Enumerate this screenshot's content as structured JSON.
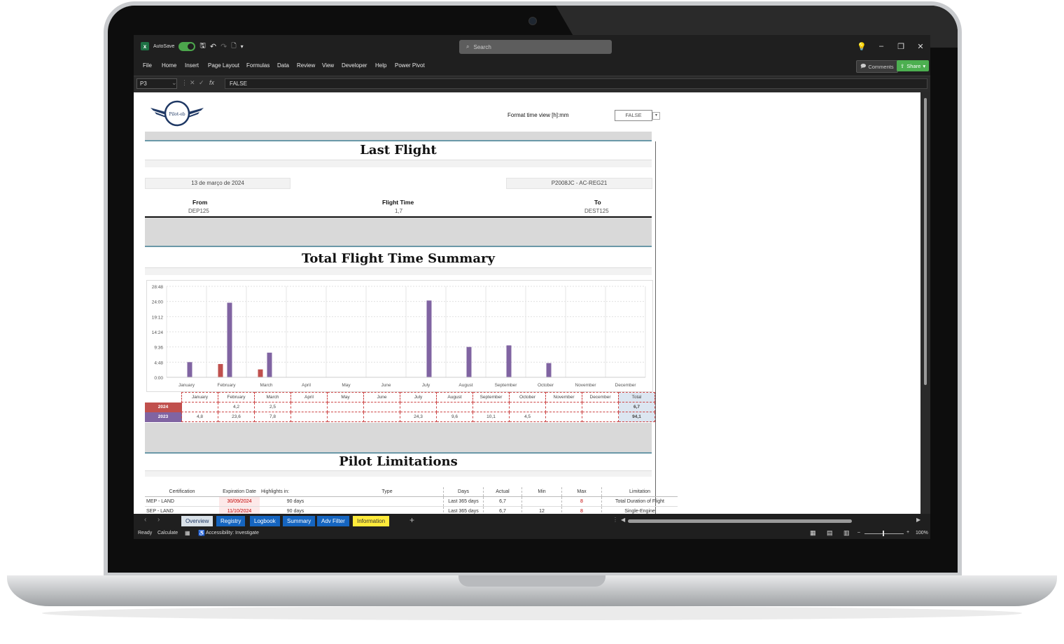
{
  "app": {
    "autosave_label": "AutoSave",
    "search_placeholder": "Search",
    "comments_label": "Comments",
    "share_label": "Share"
  },
  "menu": [
    "File",
    "Home",
    "Insert",
    "Page Layout",
    "Formulas",
    "Data",
    "Review",
    "View",
    "Developer",
    "Help",
    "Power Pivot"
  ],
  "formula_bar": {
    "cell_ref": "P3",
    "value": "FALSE"
  },
  "sheet": {
    "format_label": "Format time view [h]:mm",
    "format_value": "FALSE",
    "logo_text": "Pilot-eb",
    "last_flight": {
      "title": "Last Flight",
      "date": "13 de março de 2024",
      "aircraft": "P2008JC - AC-REG21",
      "from_label": "From",
      "from_value": "DEP125",
      "flight_time_label": "Flight Time",
      "flight_time_value": "1,7",
      "to_label": "To",
      "to_value": "DEST125"
    },
    "summary_title": "Total Flight Time Summary",
    "limitations": {
      "title": "Pilot Limitations",
      "headers": [
        "Certification",
        "Expiration Date",
        "Highlights in:",
        "Type",
        "Days",
        "Actual",
        "Min",
        "Max",
        "Limitation"
      ],
      "rows": [
        [
          "MEP - LAND",
          "30/09/2024",
          "90  days",
          "",
          "Last 365 days",
          "6,7",
          "",
          "8",
          "Total Duration of Flight"
        ],
        [
          "SEP - LAND",
          "11/10/2024",
          "90  days",
          "",
          "Last 365 days",
          "6,7",
          "12",
          "8",
          "Single-Engine"
        ]
      ]
    }
  },
  "chart_data": {
    "type": "bar",
    "categories": [
      "January",
      "February",
      "March",
      "April",
      "May",
      "June",
      "July",
      "August",
      "September",
      "October",
      "November",
      "December"
    ],
    "y_ticks": [
      "0:00",
      "4:48",
      "9:36",
      "14:24",
      "19:12",
      "24:00",
      "28:48"
    ],
    "ylim": [
      0,
      28.8
    ],
    "series": [
      {
        "name": "2024",
        "color": "#c0504d",
        "values": [
          0,
          4.2,
          2.5,
          0,
          0,
          0,
          0,
          0,
          0,
          0,
          0,
          0
        ]
      },
      {
        "name": "2023",
        "color": "#8064a2",
        "values": [
          4.8,
          23.6,
          7.8,
          0,
          0,
          0,
          24.3,
          9.6,
          10.1,
          4.5,
          0,
          0
        ]
      }
    ],
    "table": {
      "headers": [
        "January",
        "February",
        "March",
        "April",
        "May",
        "June",
        "July",
        "August",
        "September",
        "October",
        "November",
        "December",
        "Total"
      ],
      "rows": [
        {
          "label": "2024",
          "cells": [
            "",
            "4,2",
            "2,5",
            "",
            "",
            "",
            "",
            "",
            "",
            "",
            "",
            "",
            "6,7"
          ]
        },
        {
          "label": "2023",
          "cells": [
            "4,8",
            "23,6",
            "7,8",
            "",
            "",
            "",
            "24,3",
            "9,6",
            "10,1",
            "4,5",
            "",
            "",
            "94,1"
          ]
        }
      ]
    }
  },
  "tabs": [
    {
      "label": "Overview",
      "bg": "#d9e1e8",
      "fg": "#1f3864"
    },
    {
      "label": "Registry",
      "bg": "#1565c0",
      "fg": "#ffffff"
    },
    {
      "label": "Logbook",
      "bg": "#1565c0",
      "fg": "#ffffff"
    },
    {
      "label": "Summary",
      "bg": "#1565c0",
      "fg": "#ffffff"
    },
    {
      "label": "Adv Filter",
      "bg": "#1565c0",
      "fg": "#ffffff"
    },
    {
      "label": "Information",
      "bg": "#ffeb3b",
      "fg": "#333333"
    }
  ],
  "status": {
    "ready": "Ready",
    "calculate": "Calculate",
    "accessibility": "Accessibility: Investigate",
    "zoom": "100%"
  }
}
